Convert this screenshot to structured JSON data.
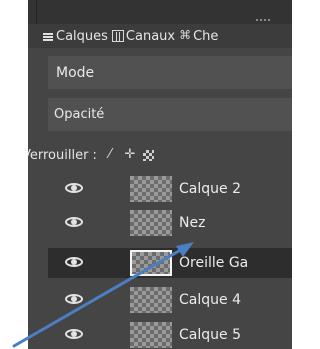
{
  "tabs": [
    {
      "label": "Calques",
      "icon": "layers-icon"
    },
    {
      "label": "Canaux",
      "icon": "channels-icon"
    },
    {
      "label": "Che",
      "icon": "paths-icon"
    }
  ],
  "mode": {
    "label": "Mode"
  },
  "opacity": {
    "label": "Opacité"
  },
  "lock": {
    "label": "Verrouiller :",
    "icons": [
      "lock-pixels-icon",
      "lock-position-icon",
      "lock-alpha-icon"
    ]
  },
  "layers": [
    {
      "name": "Calque 2",
      "selected": false
    },
    {
      "name": "Nez",
      "selected": false
    },
    {
      "name": "Oreille Ga",
      "selected": true
    },
    {
      "name": "Calque 4",
      "selected": false
    },
    {
      "name": "Calque 5",
      "selected": false
    }
  ],
  "colors": {
    "panel": "#454545",
    "selected_row": "#2d2d2d",
    "arrow": "#4a7fc1"
  }
}
